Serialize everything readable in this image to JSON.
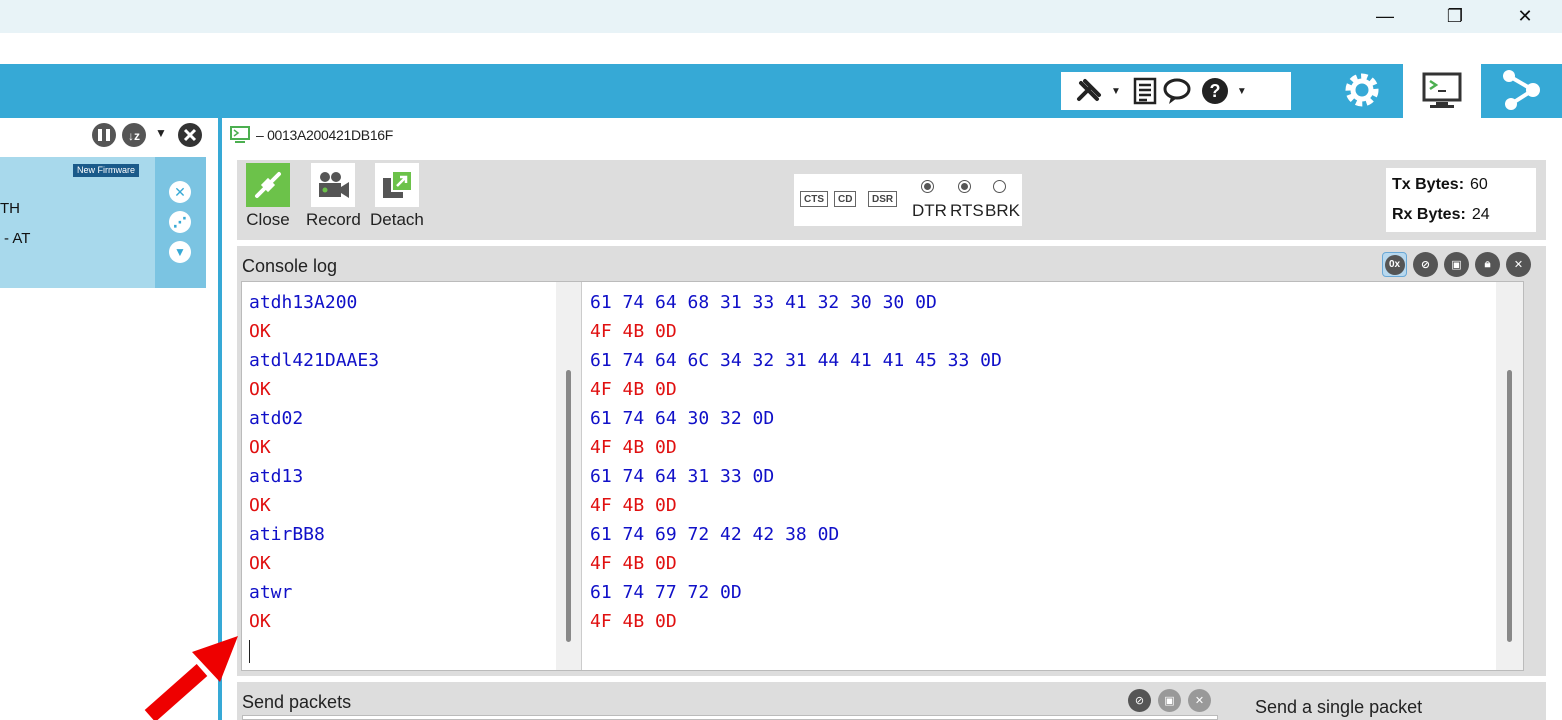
{
  "window": {
    "minimize_label": "—",
    "maximize_label": "❐",
    "close_label": "✕"
  },
  "colors": {
    "accent": "#36a9d6",
    "tx_text": "#1010c8",
    "rx_text": "#e01010",
    "card_bg": "#a8d9ec"
  },
  "header": {
    "tools": [
      "tools-icon",
      "list-icon",
      "chat-icon",
      "help-icon"
    ],
    "modes": [
      "configuration-gear-icon",
      "console-monitor-icon",
      "network-icon"
    ]
  },
  "device": {
    "badge": "New Firmware",
    "line1": "TH",
    "line2": "- AT"
  },
  "console": {
    "title": "– 0013A200421DB16F",
    "actions": {
      "close": "Close",
      "record": "Record",
      "detach": "Detach"
    },
    "signals": {
      "cts": "CTS",
      "cd": "CD",
      "dsr": "DSR",
      "dtr": "DTR",
      "rts": "RTS",
      "brk": "BRK"
    },
    "counters": {
      "tx_label": "Tx Bytes:",
      "tx_value": "60",
      "rx_label": "Rx Bytes:",
      "rx_value": "24"
    }
  },
  "log": {
    "title": "Console log",
    "hex_toggle": "0x",
    "lines": [
      {
        "dir": "tx",
        "ascii": "atdh13A200",
        "hex": "61 74 64 68 31 33 41 32 30 30 0D"
      },
      {
        "dir": "rx",
        "ascii": "OK",
        "hex": "4F 4B 0D"
      },
      {
        "dir": "tx",
        "ascii": "atdl421DAAE3",
        "hex": "61 74 64 6C 34 32 31 44 41 41 45 33 0D"
      },
      {
        "dir": "rx",
        "ascii": "OK",
        "hex": "4F 4B 0D"
      },
      {
        "dir": "tx",
        "ascii": "atd02",
        "hex": "61 74 64 30 32 0D"
      },
      {
        "dir": "rx",
        "ascii": "OK",
        "hex": "4F 4B 0D"
      },
      {
        "dir": "tx",
        "ascii": "atd13",
        "hex": "61 74 64 31 33 0D"
      },
      {
        "dir": "rx",
        "ascii": "OK",
        "hex": "4F 4B 0D"
      },
      {
        "dir": "tx",
        "ascii": "atirBB8",
        "hex": "61 74 69 72 42 42 38 0D"
      },
      {
        "dir": "rx",
        "ascii": "OK",
        "hex": "4F 4B 0D"
      },
      {
        "dir": "tx",
        "ascii": "atwr",
        "hex": "61 74 77 72 0D"
      },
      {
        "dir": "rx",
        "ascii": "OK",
        "hex": "4F 4B 0D"
      }
    ]
  },
  "send": {
    "title": "Send packets",
    "single_title": "Send a single packet"
  }
}
